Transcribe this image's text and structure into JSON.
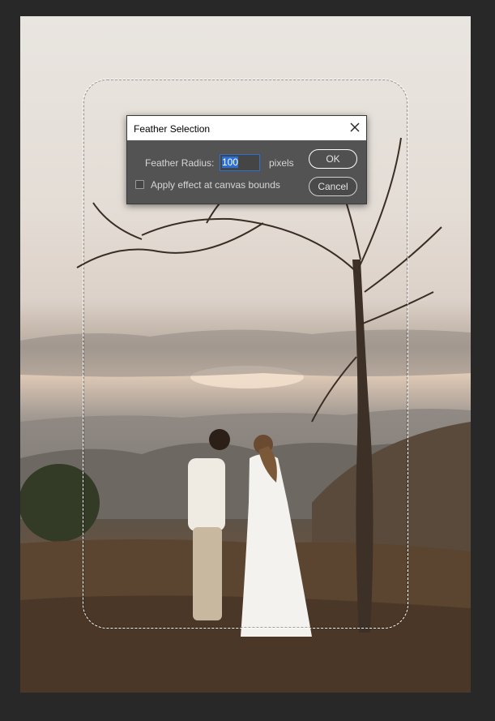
{
  "dialog": {
    "title": "Feather Selection",
    "radius_label": "Feather Radius:",
    "radius_value": "100",
    "radius_unit": "pixels",
    "ok_label": "OK",
    "cancel_label": "Cancel",
    "checkbox_label": "Apply effect at canvas bounds",
    "checkbox_checked": false
  },
  "icons": {
    "close": "close-icon"
  },
  "colors": {
    "workspace": "#282828",
    "dialog_body": "#535353",
    "input_highlight": "#2a6fd6"
  }
}
